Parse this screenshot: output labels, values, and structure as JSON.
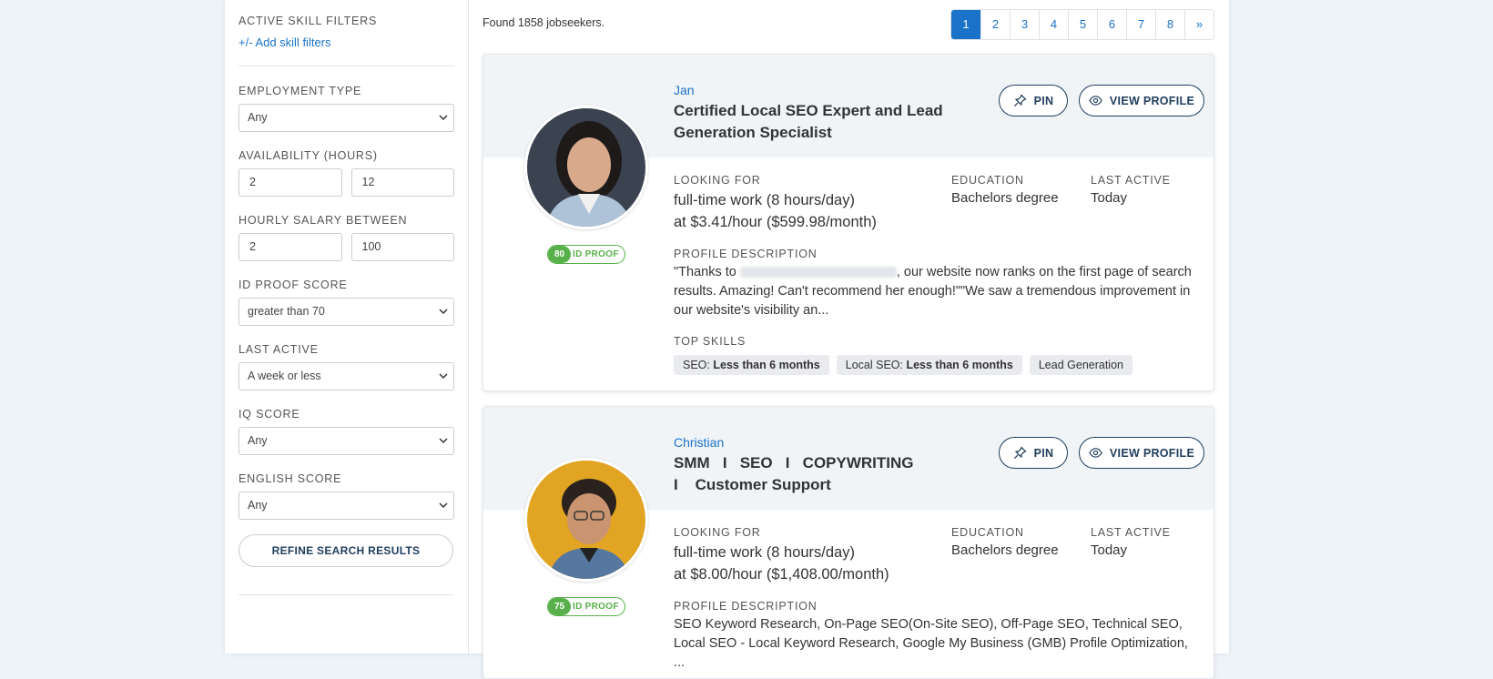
{
  "filters": {
    "active_skill_label": "ACTIVE SKILL FILTERS",
    "add_skill_link": "+/- Add skill filters",
    "employment_type": {
      "label": "EMPLOYMENT TYPE",
      "value": "Any"
    },
    "availability": {
      "label": "AVAILABILITY (HOURS)",
      "min": "2",
      "max": "12"
    },
    "salary": {
      "label": "HOURLY SALARY BETWEEN",
      "min": "2",
      "max": "100"
    },
    "id_proof": {
      "label": "ID PROOF SCORE",
      "value": "greater than 70"
    },
    "last_active": {
      "label": "LAST ACTIVE",
      "value": "A week or less"
    },
    "iq_score": {
      "label": "IQ SCORE",
      "value": "Any"
    },
    "english_score": {
      "label": "ENGLISH SCORE",
      "value": "Any"
    },
    "refine_button": "REFINE SEARCH RESULTS"
  },
  "results": {
    "found_text": "Found 1858 jobseekers.",
    "pages": [
      "1",
      "2",
      "3",
      "4",
      "5",
      "6",
      "7",
      "8",
      "»"
    ],
    "active_page": "1"
  },
  "labels": {
    "pin": "PIN",
    "view_profile": "VIEW PROFILE",
    "looking_for": "LOOKING FOR",
    "education": "EDUCATION",
    "last_active": "LAST ACTIVE",
    "profile_description": "PROFILE DESCRIPTION",
    "top_skills": "TOP SKILLS",
    "id_proof": "ID PROOF"
  },
  "candidates": [
    {
      "name": "Jan",
      "headline": "Certified Local SEO Expert and Lead Generation Specialist",
      "id_score": "80",
      "looking_for_line1": "full-time work (8 hours/day)",
      "looking_for_line2": "at $3.41/hour ($599.98/month)",
      "education": "Bachelors degree",
      "last_active": "Today",
      "desc_start": "\"Thanks to ",
      "desc_rest": ", our website now ranks on the first page of search results. Amazing! Can't recommend her enough!\"\"We saw a tremendous improvement in our website's visibility an...",
      "skills": [
        {
          "name": "SEO:",
          "level": "Less than 6 months"
        },
        {
          "name": "Local SEO:",
          "level": "Less than 6 months"
        },
        {
          "name": "Lead Generation",
          "level": ""
        }
      ]
    },
    {
      "name": "Christian",
      "headline": "SMM   I   SEO   I   COPYWRITING    I    Customer Support",
      "id_score": "75",
      "looking_for_line1": "full-time work (8 hours/day)",
      "looking_for_line2": "at $8.00/hour ($1,408.00/month)",
      "education": "Bachelors degree",
      "last_active": "Today",
      "desc": "SEO Keyword Research, On-Page SEO(On-Site SEO), Off-Page SEO, Technical SEO, Local SEO - Local Keyword Research, Google My Business (GMB) Profile Optimization, ..."
    }
  ],
  "colors": {
    "accent": "#1a73c8",
    "dark_blue": "#1f3d5c",
    "badge_green": "#58b04a"
  }
}
